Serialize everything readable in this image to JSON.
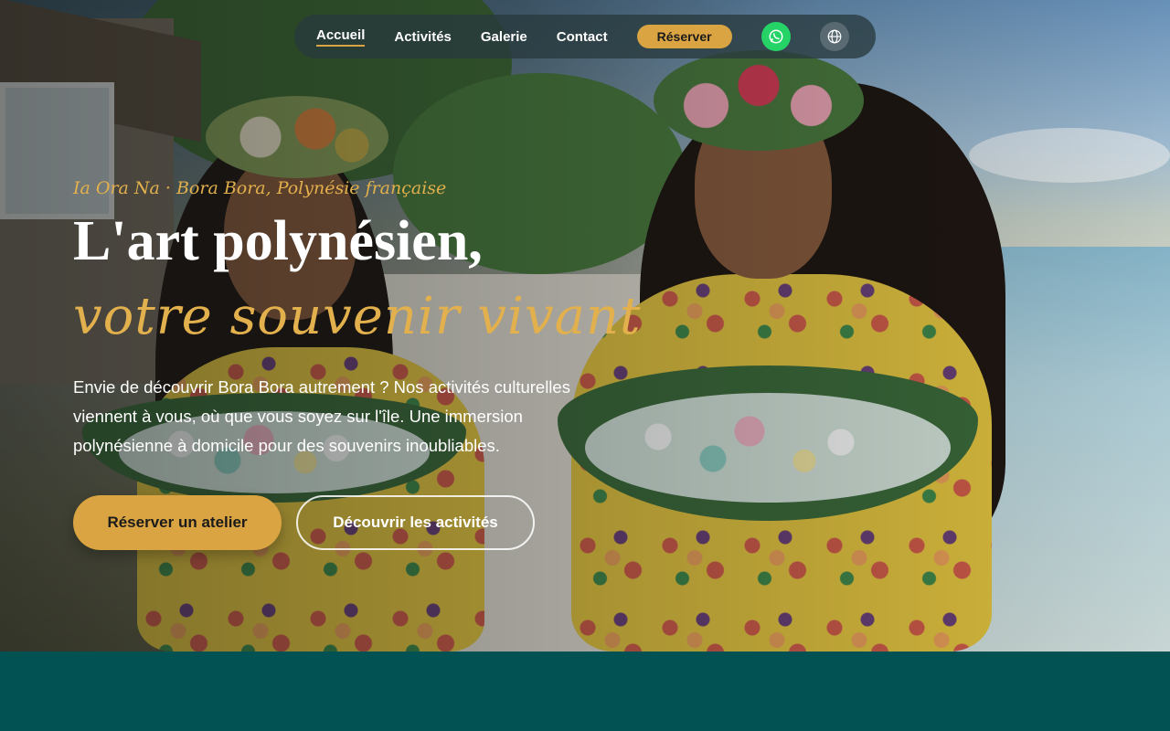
{
  "nav": {
    "links": [
      {
        "label": "Accueil"
      },
      {
        "label": "Activités"
      },
      {
        "label": "Galerie"
      },
      {
        "label": "Contact"
      }
    ],
    "reserve_label": "Réserver",
    "whatsapp_icon": "whatsapp-icon",
    "language_icon": "globe-icon"
  },
  "hero": {
    "kicker": "Ia Ora Na · Bora Bora, Polynésie française",
    "title_line1": "L'art polynésien,",
    "title_line2": "votre souvenir vivant",
    "lead": "Envie de découvrir Bora Bora autrement ? Nos activités culturelles viennent à vous, où que vous soyez sur l'île. Une immersion polynésienne à domicile pour des souvenirs inoubliables.",
    "primary_cta": "Réserver un atelier",
    "secondary_cta": "Découvrir les activités"
  },
  "colors": {
    "accent": "#d9a441",
    "band": "#025253",
    "whatsapp": "#25d366"
  }
}
